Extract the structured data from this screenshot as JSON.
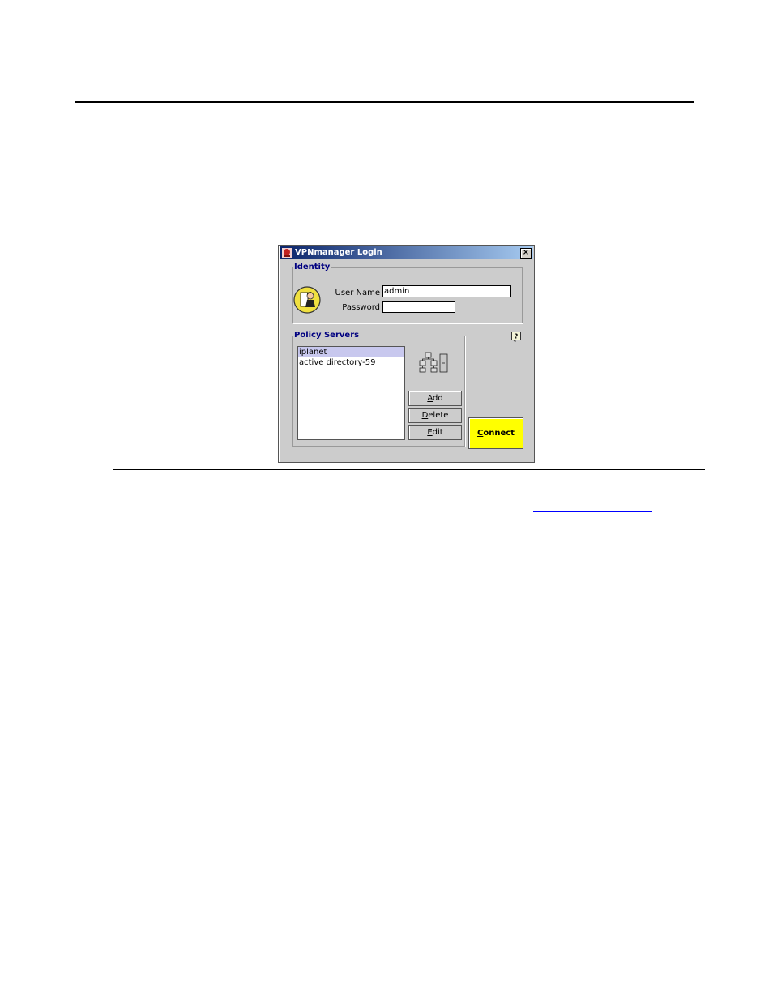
{
  "window": {
    "title": "VPNmanager Login",
    "close_label": "×"
  },
  "identity": {
    "legend": "Identity",
    "username_label": "User Name",
    "username_value": "admin",
    "password_label": "Password",
    "password_value": ""
  },
  "servers": {
    "legend": "Policy Servers",
    "items": [
      {
        "label": "iplanet",
        "selected": true
      },
      {
        "label": "active directory-59",
        "selected": false
      }
    ]
  },
  "buttons": {
    "add": {
      "accel": "A",
      "rest": "dd"
    },
    "delete": {
      "accel": "D",
      "rest": "elete"
    },
    "edit": {
      "accel": "E",
      "rest": "dit"
    },
    "connect": {
      "accel": "C",
      "rest": "onnect"
    }
  },
  "colors": {
    "connect_bg": "#ffff00",
    "title_start": "#0a246a",
    "title_end": "#a6caf0",
    "legend": "#000080"
  },
  "icons": [
    "app-icon",
    "close-icon",
    "user-avatar-icon",
    "help-icon",
    "network-servers-icon"
  ]
}
